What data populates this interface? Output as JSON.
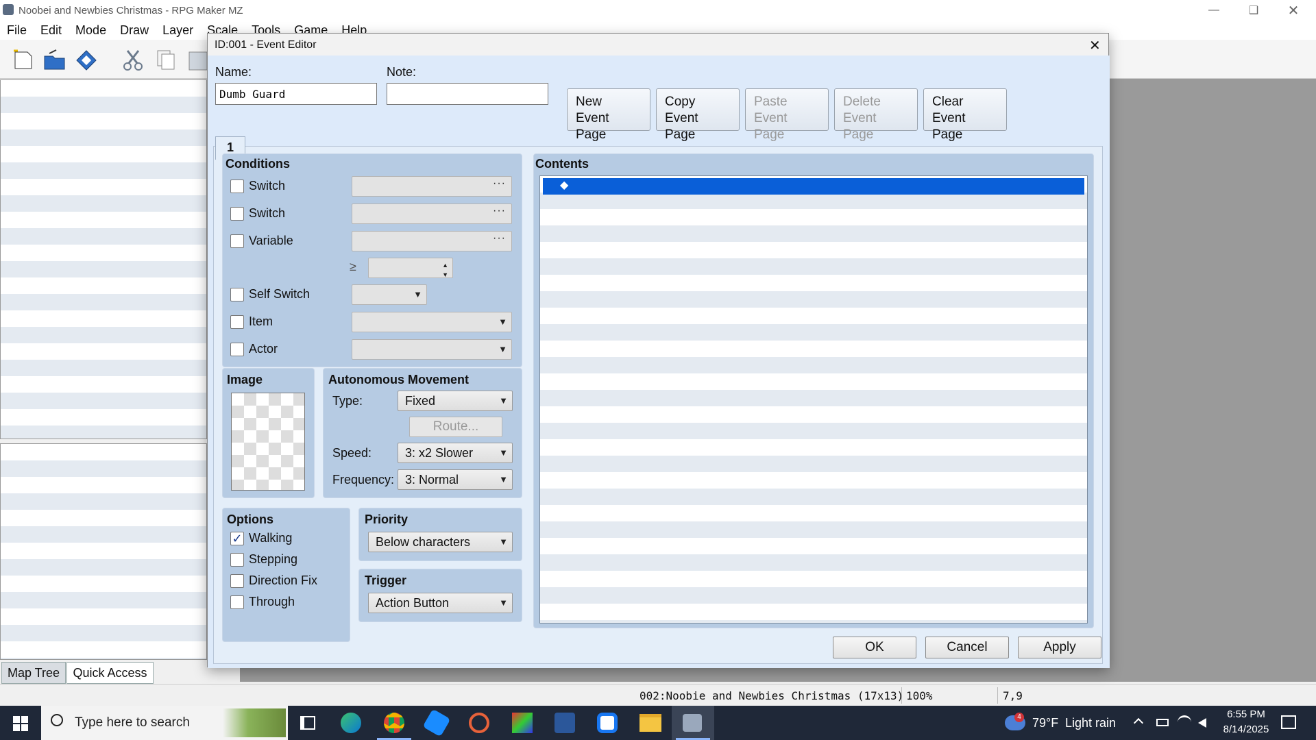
{
  "app": {
    "title": "Noobei and Newbies Christmas - RPG Maker MZ",
    "menu": [
      "File",
      "Edit",
      "Mode",
      "Draw",
      "Layer",
      "Scale",
      "Tools",
      "Game",
      "Help"
    ]
  },
  "left_tabs": [
    "Map Tree",
    "Quick Access"
  ],
  "status": {
    "map": "002:Noobie and Newbies Christmas (17x13)",
    "zoom": "100%",
    "coords": "7,9"
  },
  "dialog": {
    "title": "ID:001 - Event Editor",
    "name_label": "Name:",
    "name_value": "Dumb Guard",
    "note_label": "Note:",
    "note_value": "",
    "page_buttons": [
      {
        "line1": "New",
        "line2": "Event Page",
        "enabled": true
      },
      {
        "line1": "Copy",
        "line2": "Event Page",
        "enabled": true
      },
      {
        "line1": "Paste",
        "line2": "Event Page",
        "enabled": false
      },
      {
        "line1": "Delete",
        "line2": "Event Page",
        "enabled": false
      },
      {
        "line1": "Clear",
        "line2": "Event Page",
        "enabled": true
      }
    ],
    "page_tab": "1",
    "conditions": {
      "heading": "Conditions",
      "switch1": "Switch",
      "switch2": "Switch",
      "variable": "Variable",
      "gte": "≥",
      "self_switch": "Self Switch",
      "item": "Item",
      "actor": "Actor",
      "dots": "···"
    },
    "image_heading": "Image",
    "movement": {
      "heading": "Autonomous Movement",
      "type_label": "Type:",
      "type_value": "Fixed",
      "route_button": "Route...",
      "speed_label": "Speed:",
      "speed_value": "3: x2 Slower",
      "freq_label": "Frequency:",
      "freq_value": "3: Normal"
    },
    "options": {
      "heading": "Options",
      "walking": "Walking",
      "walking_checked": true,
      "stepping": "Stepping",
      "direction_fix": "Direction Fix",
      "through": "Through",
      "checkmark": "✓"
    },
    "priority": {
      "heading": "Priority",
      "value": "Below characters"
    },
    "trigger": {
      "heading": "Trigger",
      "value": "Action Button"
    },
    "contents": {
      "heading": "Contents",
      "first_line": "◆"
    },
    "ok": "OK",
    "cancel": "Cancel",
    "apply": "Apply",
    "close": "✕",
    "dropdown_arrow": "▼"
  },
  "taskbar": {
    "search_placeholder": "Type here to search",
    "weather_temp": "79°F",
    "weather_text": "Light rain",
    "weather_badge": "4",
    "time": "6:55 PM",
    "date": "8/14/2025"
  },
  "colors": {
    "dialog_bg": "#ddeafa",
    "group_bg": "#b6cbe3",
    "selection": "#0a5fd8",
    "taskbar": "#1f2838"
  }
}
